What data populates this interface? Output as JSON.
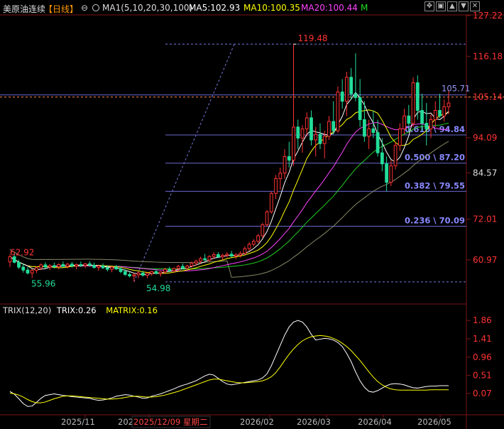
{
  "header": {
    "symbol": "美原油连续",
    "period": "【日线】",
    "ma_label": "MA1(5,10,20,30,100)",
    "ma5": "MA5:102.93",
    "ma10": "MA10:100.35",
    "ma20": "MA20:100.44",
    "mode": "M",
    "colors": {
      "symbol": "#dddddd",
      "period": "#ff9900",
      "ma_label": "#dddddd",
      "ma5": "#ffffff",
      "ma10": "#ffff00",
      "ma20": "#ff44ff",
      "mode": "#22dd22"
    }
  },
  "window_controls": {
    "icons": [
      "expand-icon",
      "restore-icon",
      "arrow-up-icon",
      "arrow-down-icon",
      "close-icon"
    ],
    "glyphs": [
      "✥",
      "▣",
      "▲",
      "▼",
      "✕"
    ]
  },
  "price_axis": {
    "ticks": [
      "127.22",
      "116.18",
      "105.14",
      "94.09",
      "84.57",
      "72.01",
      "60.97"
    ],
    "highlight": "84.57"
  },
  "annotations": {
    "high": "119.48",
    "low_left": "55.96",
    "low_mid": "54.98",
    "prev_high": "62.92",
    "level": "105.71",
    "current": "105.14"
  },
  "fib_levels": [
    {
      "label": "0.618 \\ 94.84",
      "value": 94.84
    },
    {
      "label": "0.500 \\ 87.20",
      "value": 87.2
    },
    {
      "label": "0.382 \\ 79.55",
      "value": 79.55
    },
    {
      "label": "0.236 \\ 70.09",
      "value": 70.09
    }
  ],
  "date_axis": {
    "ticks": [
      "2025/11",
      "202",
      "2025/12/09 星期二",
      "2026/02",
      "2026/03",
      "2026/04",
      "2026/05"
    ],
    "highlight_index": 2
  },
  "indicator": {
    "title": "TRIX(12,20)",
    "trix": "TRIX:0.26",
    "matrix": "MATRIX:0.16",
    "ticks": [
      "1.86",
      "1.41",
      "0.96",
      "0.51",
      "0.07"
    ]
  },
  "chart_data": {
    "type": "candlestick",
    "y_range": [
      54,
      127.22
    ],
    "days": [
      [
        0,
        60.4,
        62.5,
        59.0,
        61.8
      ],
      [
        1,
        61.8,
        62.9,
        60.0,
        60.3
      ],
      [
        2,
        60.3,
        61.0,
        58.5,
        59.0
      ],
      [
        3,
        59.0,
        60.0,
        57.5,
        58.2
      ],
      [
        4,
        58.2,
        59.0,
        57.0,
        57.4
      ],
      [
        5,
        57.4,
        58.5,
        56.0,
        58.1
      ],
      [
        6,
        58.1,
        59.2,
        57.4,
        58.8
      ],
      [
        7,
        58.8,
        60.0,
        58.2,
        59.6
      ],
      [
        8,
        59.6,
        60.3,
        58.6,
        59.0
      ],
      [
        9,
        59.0,
        59.8,
        58.2,
        59.4
      ],
      [
        10,
        59.4,
        60.2,
        58.6,
        59.1
      ],
      [
        11,
        59.1,
        60.0,
        58.4,
        59.7
      ],
      [
        12,
        59.7,
        60.5,
        58.9,
        59.2
      ],
      [
        13,
        59.2,
        60.1,
        58.6,
        59.8
      ],
      [
        14,
        59.8,
        60.4,
        58.9,
        59.3
      ],
      [
        15,
        59.3,
        60.0,
        58.4,
        59.7
      ],
      [
        16,
        59.7,
        60.5,
        59.0,
        59.4
      ],
      [
        17,
        59.4,
        60.1,
        58.7,
        59.9
      ],
      [
        18,
        59.9,
        60.6,
        59.1,
        59.5
      ],
      [
        19,
        59.5,
        60.2,
        58.6,
        58.9
      ],
      [
        20,
        58.9,
        59.6,
        58.0,
        59.3
      ],
      [
        21,
        59.3,
        60.0,
        58.5,
        58.8
      ],
      [
        22,
        58.8,
        59.5,
        57.8,
        58.4
      ],
      [
        23,
        58.4,
        59.2,
        57.6,
        59.0
      ],
      [
        24,
        59.0,
        59.6,
        58.2,
        58.5
      ],
      [
        25,
        58.5,
        59.0,
        57.3,
        57.8
      ],
      [
        26,
        57.8,
        58.4,
        56.6,
        57.0
      ],
      [
        27,
        57.0,
        57.6,
        56.2,
        56.6
      ],
      [
        28,
        56.6,
        57.3,
        54.98,
        56.9
      ],
      [
        29,
        56.9,
        57.9,
        56.0,
        57.4
      ],
      [
        30,
        57.4,
        58.0,
        56.4,
        56.8
      ],
      [
        31,
        56.8,
        57.6,
        56.0,
        57.3
      ],
      [
        32,
        57.3,
        58.0,
        56.6,
        57.8
      ],
      [
        33,
        57.8,
        58.4,
        57.0,
        57.3
      ],
      [
        34,
        57.3,
        57.9,
        56.4,
        57.7
      ],
      [
        35,
        57.7,
        58.8,
        57.1,
        58.4
      ],
      [
        36,
        58.4,
        59.1,
        57.6,
        58.0
      ],
      [
        37,
        58.0,
        58.9,
        57.4,
        58.6
      ],
      [
        38,
        58.6,
        59.6,
        58.0,
        59.2
      ],
      [
        39,
        59.2,
        60.0,
        58.4,
        58.7
      ],
      [
        40,
        58.7,
        59.6,
        58.2,
        59.3
      ],
      [
        41,
        59.3,
        60.5,
        58.8,
        60.1
      ],
      [
        42,
        60.1,
        61.0,
        59.4,
        60.6
      ],
      [
        43,
        60.6,
        61.8,
        60.0,
        61.3
      ],
      [
        44,
        61.3,
        62.6,
        60.8,
        60.9
      ],
      [
        45,
        60.9,
        62.2,
        60.4,
        61.9
      ],
      [
        46,
        61.9,
        63.0,
        61.2,
        62.4
      ],
      [
        47,
        62.4,
        63.1,
        61.5,
        61.8
      ],
      [
        48,
        61.8,
        62.6,
        61.0,
        62.2
      ],
      [
        49,
        62.2,
        63.0,
        61.6,
        62.5
      ],
      [
        50,
        62.5,
        63.4,
        61.7,
        62.0
      ],
      [
        51,
        62.0,
        62.8,
        61.2,
        62.3
      ],
      [
        52,
        62.3,
        63.3,
        61.6,
        62.7
      ],
      [
        53,
        62.7,
        64.6,
        62.3,
        64.0
      ],
      [
        54,
        64.0,
        65.8,
        63.4,
        65.2
      ],
      [
        55,
        65.2,
        66.6,
        64.6,
        66.0
      ],
      [
        56,
        66.0,
        68.0,
        65.5,
        67.5
      ],
      [
        57,
        67.5,
        71.0,
        67.0,
        70.5
      ],
      [
        58,
        70.5,
        74.5,
        70.0,
        74.0
      ],
      [
        59,
        74.0,
        79.5,
        73.5,
        79.0
      ],
      [
        60,
        79.0,
        84.0,
        77.5,
        83.0
      ],
      [
        61,
        83.0,
        86.0,
        80.0,
        84.5
      ],
      [
        62,
        84.5,
        91.0,
        83.0,
        89.0
      ],
      [
        63,
        89.0,
        93.0,
        86.0,
        88.0
      ],
      [
        64,
        88.0,
        119.48,
        86.5,
        97.0
      ],
      [
        65,
        97.0,
        99.0,
        91.0,
        94.0
      ],
      [
        66,
        94.0,
        97.5,
        90.0,
        96.5
      ],
      [
        67,
        96.5,
        101.0,
        94.5,
        99.5
      ],
      [
        68,
        99.5,
        101.5,
        92.0,
        93.5
      ],
      [
        69,
        93.5,
        97.0,
        89.0,
        95.0
      ],
      [
        70,
        95.0,
        98.0,
        91.0,
        92.5
      ],
      [
        71,
        92.5,
        96.0,
        88.5,
        94.5
      ],
      [
        72,
        94.5,
        100.0,
        93.5,
        98.5
      ],
      [
        73,
        98.5,
        104.0,
        95.0,
        96.0
      ],
      [
        74,
        96.0,
        108.0,
        95.5,
        106.5
      ],
      [
        75,
        106.5,
        110.0,
        102.0,
        104.0
      ],
      [
        76,
        104.0,
        112.0,
        100.0,
        110.5
      ],
      [
        77,
        110.5,
        113.0,
        104.5,
        106.0
      ],
      [
        78,
        106.0,
        117.0,
        104.0,
        105.0
      ],
      [
        79,
        105.0,
        110.0,
        97.0,
        99.0
      ],
      [
        80,
        99.0,
        104.0,
        93.0,
        94.5
      ],
      [
        81,
        94.5,
        99.0,
        91.0,
        96.5
      ],
      [
        82,
        96.5,
        101.5,
        94.0,
        95.5
      ],
      [
        83,
        95.5,
        99.0,
        89.0,
        90.0
      ],
      [
        84,
        90.0,
        94.0,
        85.0,
        87.0
      ],
      [
        85,
        87.0,
        89.0,
        79.55,
        82.0
      ],
      [
        86,
        82.0,
        88.0,
        81.0,
        86.5
      ],
      [
        87,
        86.5,
        93.0,
        85.5,
        92.0
      ],
      [
        88,
        92.0,
        98.0,
        90.5,
        96.5
      ],
      [
        89,
        96.5,
        102.0,
        95.0,
        100.0
      ],
      [
        90,
        100.0,
        103.0,
        96.0,
        98.0
      ],
      [
        91,
        98.0,
        110.5,
        97.0,
        109.0
      ],
      [
        92,
        109.0,
        111.0,
        99.0,
        101.5
      ],
      [
        93,
        101.5,
        106.0,
        96.0,
        98.0
      ],
      [
        94,
        98.0,
        103.5,
        92.0,
        96.5
      ],
      [
        95,
        96.5,
        100.5,
        94.0,
        99.0
      ],
      [
        96,
        99.0,
        104.0,
        97.0,
        101.5
      ],
      [
        97,
        101.5,
        106.0,
        99.5,
        100.0
      ],
      [
        98,
        100.0,
        104.5,
        98.5,
        102.5
      ],
      [
        99,
        102.5,
        106.8,
        100.5,
        103.5
      ]
    ],
    "fib_anchor": {
      "low": 54.98,
      "high": 119.48
    },
    "trix_series": [
      0.12,
      0.05,
      -0.06,
      -0.18,
      -0.25,
      -0.24,
      -0.15,
      -0.05,
      0.02,
      0.04,
      0.06,
      0.04,
      0.02,
      0.01,
      -0.01,
      -0.02,
      -0.03,
      -0.04,
      -0.05,
      -0.08,
      -0.1,
      -0.09,
      -0.07,
      -0.04,
      0.0,
      0.02,
      0.04,
      0.03,
      0.0,
      -0.02,
      -0.05,
      -0.04,
      0.0,
      0.03,
      0.06,
      0.1,
      0.14,
      0.18,
      0.23,
      0.27,
      0.3,
      0.34,
      0.38,
      0.44,
      0.5,
      0.54,
      0.52,
      0.44,
      0.36,
      0.3,
      0.28,
      0.3,
      0.32,
      0.34,
      0.36,
      0.38,
      0.4,
      0.45,
      0.55,
      0.75,
      1.0,
      1.25,
      1.5,
      1.7,
      1.82,
      1.86,
      1.82,
      1.7,
      1.52,
      1.38,
      1.4,
      1.42,
      1.41,
      1.38,
      1.32,
      1.22,
      1.05,
      0.85,
      0.6,
      0.38,
      0.22,
      0.12,
      0.1,
      0.14,
      0.2,
      0.26,
      0.3,
      0.31,
      0.3,
      0.28,
      0.24,
      0.21,
      0.2,
      0.22,
      0.24,
      0.25,
      0.25,
      0.26,
      0.26,
      0.26
    ],
    "matrix_series": [
      0.08,
      0.06,
      0.03,
      -0.02,
      -0.08,
      -0.13,
      -0.16,
      -0.16,
      -0.14,
      -0.1,
      -0.06,
      -0.03,
      0.0,
      0.01,
      0.01,
      0.0,
      -0.01,
      -0.02,
      -0.03,
      -0.04,
      -0.05,
      -0.06,
      -0.07,
      -0.07,
      -0.06,
      -0.05,
      -0.03,
      -0.01,
      0.0,
      0.0,
      -0.01,
      -0.02,
      -0.02,
      -0.01,
      0.01,
      0.03,
      0.06,
      0.09,
      0.12,
      0.16,
      0.2,
      0.24,
      0.28,
      0.32,
      0.36,
      0.4,
      0.42,
      0.42,
      0.4,
      0.38,
      0.36,
      0.34,
      0.33,
      0.33,
      0.34,
      0.35,
      0.36,
      0.38,
      0.42,
      0.48,
      0.58,
      0.72,
      0.88,
      1.03,
      1.16,
      1.27,
      1.36,
      1.42,
      1.46,
      1.48,
      1.49,
      1.48,
      1.46,
      1.42,
      1.37,
      1.3,
      1.22,
      1.12,
      1.0,
      0.88,
      0.74,
      0.6,
      0.47,
      0.36,
      0.28,
      0.22,
      0.18,
      0.16,
      0.15,
      0.15,
      0.15,
      0.15,
      0.15,
      0.15,
      0.15,
      0.16,
      0.16,
      0.16,
      0.16,
      0.16
    ]
  }
}
